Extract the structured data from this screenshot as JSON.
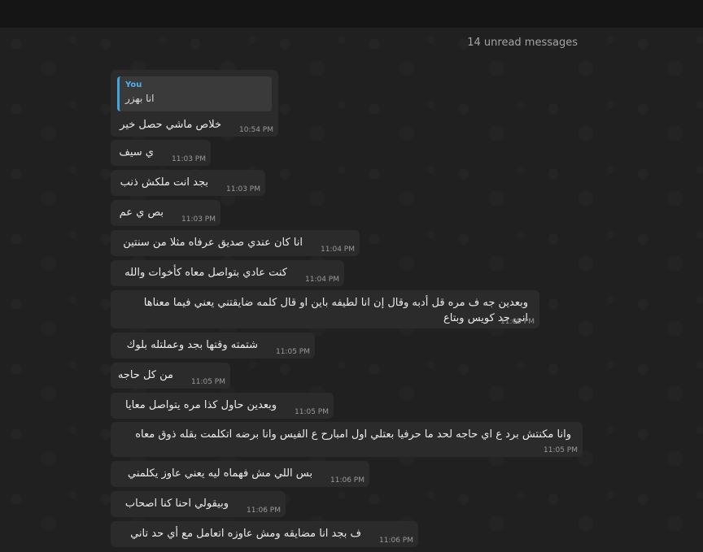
{
  "unread_label": "14 unread messages",
  "reply": {
    "name": "You",
    "text": "انا بهزر"
  },
  "messages": [
    {
      "text": "خلاص ماشي حصل خير",
      "time": "10:54 PM"
    },
    {
      "text": "ي سيف",
      "time": "11:03 PM"
    },
    {
      "text": "بجد انت ملكش ذنب",
      "time": "11:03 PM"
    },
    {
      "text": "بص ي عم",
      "time": "11:03 PM"
    },
    {
      "text": "انا كان عندي صديق عرفاه مثلا من سنتين",
      "time": "11:04 PM"
    },
    {
      "text": "كنت عادي بتواصل معاه كأخوات والله",
      "time": "11:04 PM"
    },
    {
      "text": "وبعدين جه ف مره قل أدبه وقال إن انا لطيفه باين او قال كلمه ضايقتني يعني فيما معناها",
      "text2": "اني حد كويس وبتاع",
      "time": "11:05 PM"
    },
    {
      "text": "شتمته وقتها بجد وعملتله بلوك",
      "time": "11:05 PM"
    },
    {
      "text": "من كل حاجه",
      "time": "11:05 PM"
    },
    {
      "text": "وبعدين حاول كذا مره يتواصل معايا",
      "time": "11:05 PM"
    },
    {
      "text": "وانا مكنتش برد ع اي حاجه لحد ما حرفيا بعتلي اول امبارح ع الفيس وانا برضه اتكلمت بقله ذوق معاه",
      "time": "11:05 PM"
    },
    {
      "text": "بس اللي مش فهماه ليه يعني عاوز يكلمني",
      "time": "11:06 PM"
    },
    {
      "text": "وبيقولي احنا  كنا اصحاب",
      "time": "11:06 PM"
    },
    {
      "text": "ف بجد انا مضايقه ومش عاوزه اتعامل مع أي حد تاني",
      "time": "11:06 PM"
    }
  ]
}
